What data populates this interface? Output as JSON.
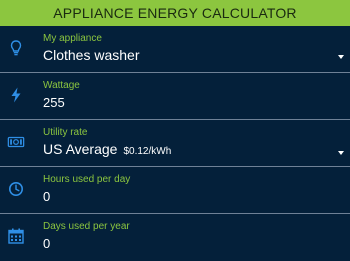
{
  "header": {
    "title": "APPLIANCE ENERGY CALCULATOR"
  },
  "colors": {
    "header_bg": "#8cc63f",
    "background": "#04203a",
    "label": "#8cc63f",
    "icon": "#2f8fe6",
    "divider": "#6f8196"
  },
  "fields": {
    "appliance": {
      "label": "My appliance",
      "value": "Clothes washer",
      "icon": "lightbulb-icon"
    },
    "wattage": {
      "label": "Wattage",
      "value": "255",
      "icon": "lightning-bolt-icon"
    },
    "utility_rate": {
      "label": "Utility rate",
      "value": "US Average",
      "detail": "$0.12/kWh",
      "icon": "money-bill-icon"
    },
    "hours_per_day": {
      "label": "Hours used per day",
      "value": "0",
      "icon": "clock-icon"
    },
    "days_per_year": {
      "label": "Days used per year",
      "value": "0",
      "icon": "calendar-icon"
    }
  }
}
